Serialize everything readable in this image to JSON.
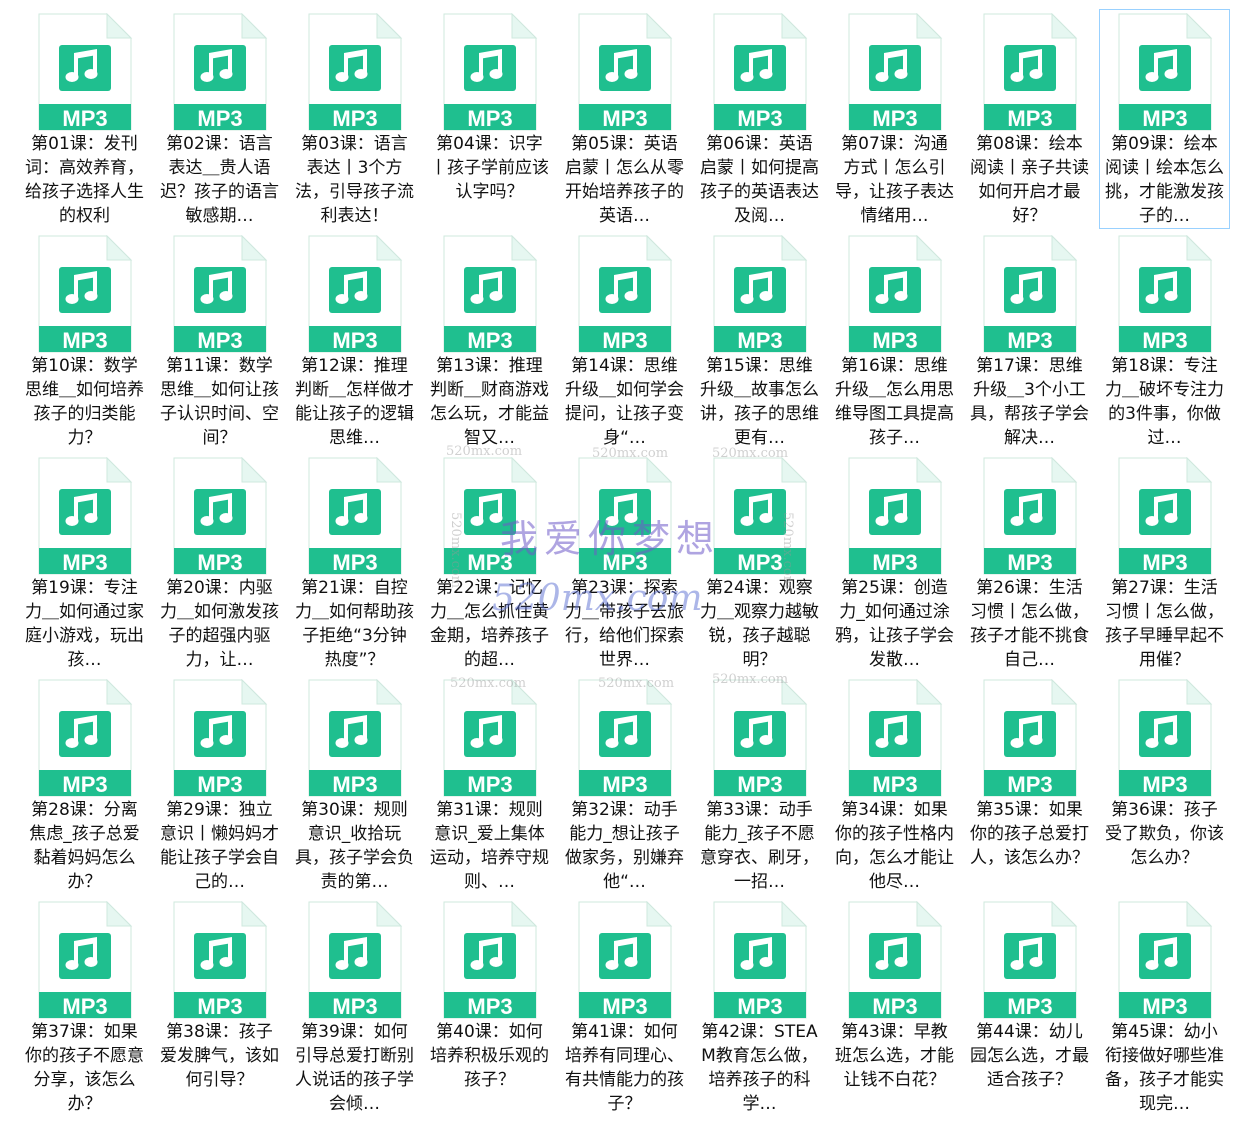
{
  "icon": {
    "name": "music-file-icon",
    "label": "MP3",
    "color": "#1fbf8f",
    "page_color": "#ffffff",
    "fold_color": "#e6f7f1"
  },
  "selection_color": "#99d1ff",
  "files": [
    {
      "name": "第01课：发刊词：高效养育，给孩子选择人生的权利"
    },
    {
      "name": "第02课：语言表达＿贵人语迟？孩子的语言敏感期…"
    },
    {
      "name": "第03课：语言表达丨3个方法，引导孩子流利表达！"
    },
    {
      "name": "第04课：识字丨孩子学前应该认字吗？"
    },
    {
      "name": "第05课：英语启蒙丨怎么从零开始培养孩子的英语…"
    },
    {
      "name": "第06课：英语启蒙丨如何提高孩子的英语表达及阅…"
    },
    {
      "name": "第07课：沟通方式丨怎么引导，让孩子表达情绪用…"
    },
    {
      "name": "第08课：绘本阅读丨亲子共读如何开启才最好？"
    },
    {
      "name": "第09课：绘本阅读丨绘本怎么挑，才能激发孩子的…",
      "selected": true
    },
    {
      "name": "第10课：数学思维＿如何培养孩子的归类能力？"
    },
    {
      "name": "第11课：数学思维＿如何让孩子认识时间、空间？"
    },
    {
      "name": "第12课：推理判断＿怎样做才能让孩子的逻辑思维…"
    },
    {
      "name": "第13课：推理判断＿财商游戏怎么玩，才能益智又…"
    },
    {
      "name": "第14课：思维升级＿如何学会提问，让孩子变身“…"
    },
    {
      "name": "第15课：思维升级＿故事怎么讲，孩子的思维更有…"
    },
    {
      "name": "第16课：思维升级＿怎么用思维导图工具提高孩子…"
    },
    {
      "name": "第17课：思维升级＿3个小工具，帮孩子学会解决…"
    },
    {
      "name": "第18课：专注力＿破坏专注力的3件事，你做过…"
    },
    {
      "name": "第19课：专注力＿如何通过家庭小游戏，玩出孩…"
    },
    {
      "name": "第20课：内驱力＿如何激发孩子的超强内驱力，让…"
    },
    {
      "name": "第21课：自控力＿如何帮助孩子拒绝“3分钟热度”？"
    },
    {
      "name": "第22课：记忆力＿怎么抓住黄金期，培养孩子的超…"
    },
    {
      "name": "第23课：探索力＿带孩子去旅行，给他们探索世界…"
    },
    {
      "name": "第24课：观察力＿观察力越敏锐，孩子越聪明？"
    },
    {
      "name": "第25课：创造力_如何通过涂鸦，让孩子学会发散…"
    },
    {
      "name": "第26课：生活习惯丨怎么做，孩子才能不挑食自己…"
    },
    {
      "name": "第27课：生活习惯丨怎么做，孩子早睡早起不用催？"
    },
    {
      "name": "第28课：分离焦虑_孩子总爱黏着妈妈怎么办？"
    },
    {
      "name": "第29课：独立意识丨懒妈妈才能让孩子学会自己的…"
    },
    {
      "name": "第30课：规则意识_收拾玩具，孩子学会负责的第…"
    },
    {
      "name": "第31课：规则意识_爱上集体运动，培养守规则、…"
    },
    {
      "name": "第32课：动手能力_想让孩子做家务，别嫌弃他“…"
    },
    {
      "name": "第33课：动手能力_孩子不愿意穿衣、刷牙，一招…"
    },
    {
      "name": "第34课：如果你的孩子性格内向，怎么才能让他尽…"
    },
    {
      "name": "第35课：如果你的孩子总爱打人，该怎么办？"
    },
    {
      "name": "第36课：孩子受了欺负，你该怎么办？"
    },
    {
      "name": "第37课：如果你的孩子不愿意分享，该怎么办？"
    },
    {
      "name": "第38课：孩子爱发脾气，该如何引导？"
    },
    {
      "name": "第39课：如何引导总爱打断别人说话的孩子学会倾…"
    },
    {
      "name": "第40课：如何培养积极乐观的孩子？"
    },
    {
      "name": "第41课：如何培养有同理心、有共情能力的孩子？"
    },
    {
      "name": "第42课：STEAM教育怎么做，培养孩子的科学…"
    },
    {
      "name": "第43课：早教班怎么选，才能让钱不白花？"
    },
    {
      "name": "第44课：幼儿园怎么选，才最适合孩子？"
    },
    {
      "name": "第45课：幼小衔接做好哪些准备，孩子才能实现完…"
    }
  ],
  "watermark": {
    "main": "我爱你梦想",
    "site": "520mx.com",
    "small": "520mx.com"
  }
}
